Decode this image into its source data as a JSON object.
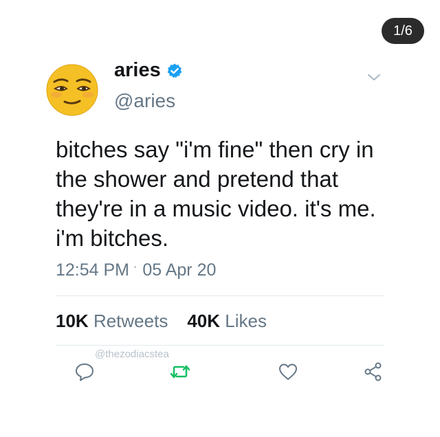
{
  "pager": {
    "label": "1/6"
  },
  "tweet": {
    "display_name": "aries",
    "handle": "@aries",
    "text": "bitches say \"i'm fine\" then cry in the shower and pretend that they're in a music video. it's me. i'm bitches.",
    "time": "12:54 PM",
    "separator": "·",
    "date": "05 Apr 20"
  },
  "stats": {
    "retweets_count": "10K",
    "retweets_label": "Retweets",
    "likes_count": "40K",
    "likes_label": "Likes"
  },
  "watermark": "@thezodiacstea",
  "icons": {
    "avatar": "pleased-face-emoji",
    "verified": "verified-badge-icon",
    "menu": "chevron-down-icon",
    "reply": "reply-icon",
    "retweet": "retweet-icon",
    "like": "heart-icon",
    "share": "share-icon"
  },
  "colors": {
    "verified_blue": "#1da1f2",
    "retweet_green": "#17bf63",
    "secondary_text": "#657786",
    "counter_bg": "#2b2b2b"
  }
}
